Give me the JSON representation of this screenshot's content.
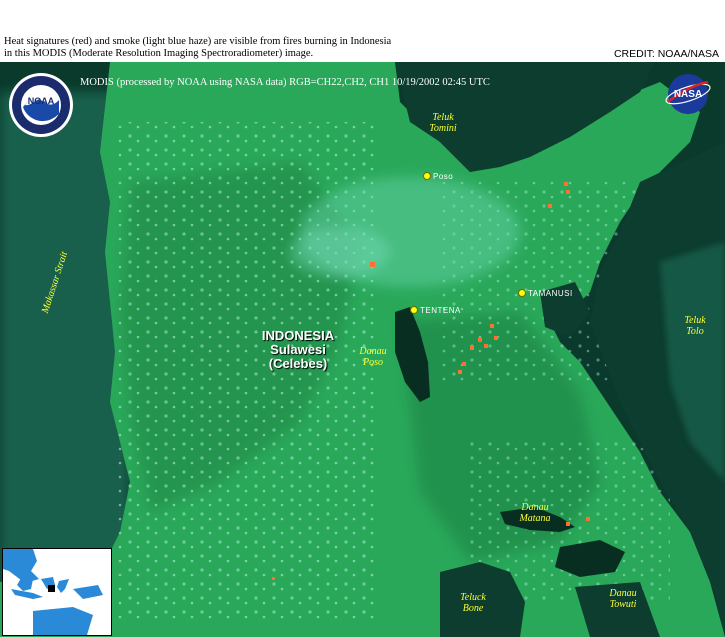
{
  "caption": {
    "line1": "Heat signatures (red) and smoke (light blue haze) are visible from fires burning in Indonesia",
    "line2": "in this MODIS (Moderate Resolution Imaging Spectroradiometer) image."
  },
  "credit": "CREDIT: NOAA/NASA",
  "map": {
    "header": "MODIS  (processed by NOAA using NASA data)  RGB=CH22,CH2, CH1  10/19/2002  02:45 UTC",
    "logos": {
      "left": "noaa-logo",
      "right": "nasa-logo"
    },
    "country": {
      "name": "INDONESIA",
      "island": "Sulawesi",
      "alt": "(Celebes)"
    },
    "water_labels": {
      "teluk_tomini": {
        "l1": "Teluk",
        "l2": "Tomini"
      },
      "makassar": "Makassar Strait",
      "teluk_tolo": {
        "l1": "Teluk",
        "l2": "Tolo"
      },
      "danau_poso": {
        "l1": "Danau",
        "l2": "Poso"
      },
      "danau_matana": {
        "l1": "Danau",
        "l2": "Matana"
      },
      "teluck_bone": {
        "l1": "Teluck",
        "l2": "Bone"
      },
      "danau_towuti": {
        "l1": "Danau",
        "l2": "Towuti"
      }
    },
    "cities": {
      "poso": "Poso",
      "tentena": "Tentena",
      "tamanusi": "Tamanusi"
    },
    "colors": {
      "land": "#2aa85a",
      "water": "#0a3a2c",
      "fire": "#ff7030",
      "label": "#ffff33",
      "city_dot": "#ffff00"
    }
  }
}
